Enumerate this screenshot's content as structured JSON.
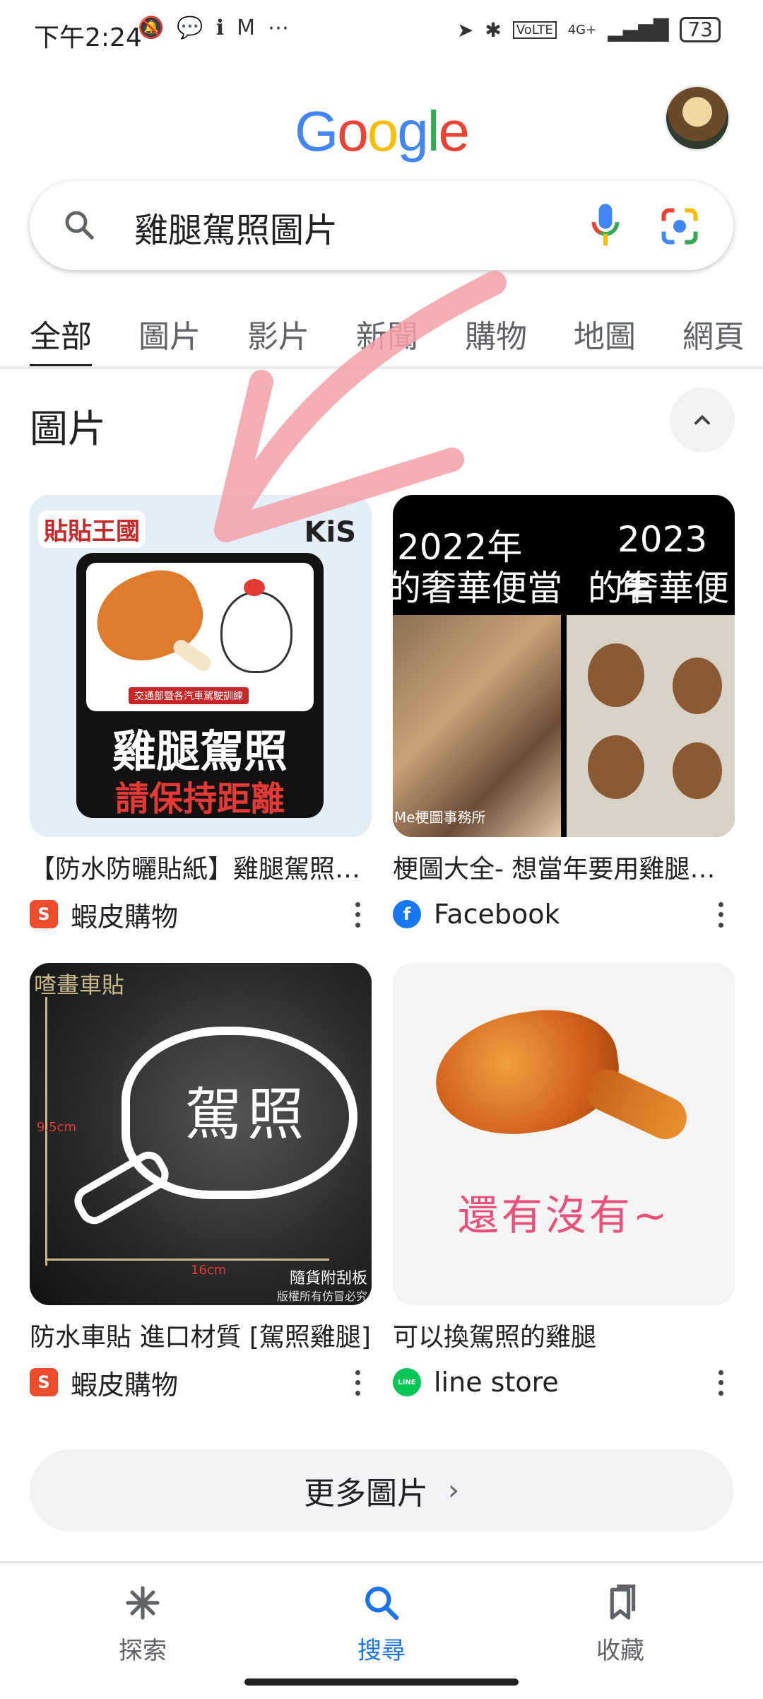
{
  "status_bar": {
    "time": "下午2:24",
    "network": "4G+",
    "battery": "73"
  },
  "header": {
    "logo_letters": [
      {
        "ch": "G",
        "color": "blue"
      },
      {
        "ch": "o",
        "color": "red"
      },
      {
        "ch": "o",
        "color": "yellow"
      },
      {
        "ch": "g",
        "color": "blue"
      },
      {
        "ch": "l",
        "color": "green"
      },
      {
        "ch": "e",
        "color": "red"
      }
    ]
  },
  "search": {
    "query": "雞腿駕照圖片"
  },
  "tabs": [
    {
      "label": "全部",
      "active": true
    },
    {
      "label": "圖片",
      "active": false
    },
    {
      "label": "影片",
      "active": false
    },
    {
      "label": "新聞",
      "active": false
    },
    {
      "label": "購物",
      "active": false
    },
    {
      "label": "地圖",
      "active": false
    },
    {
      "label": "網頁",
      "active": false
    }
  ],
  "images_section": {
    "title": "圖片",
    "cards": [
      {
        "title": "【防水防曬貼紙】雞腿駕照請保持距離",
        "source": "蝦皮購物",
        "thumb_text_top": "貼貼王國",
        "thumb_text_brand": "KiS",
        "thumb_text_main": "雞腿駕照",
        "thumb_text_sub": "請保持距離",
        "thumb_text_small": "交通部暨各汽車駕駛訓練"
      },
      {
        "title": "梗圖大全- 想當年要用雞腿換駕照",
        "source": "Facebook",
        "thumb_text_left": "2022年",
        "thumb_text_left2": "的奢華便當",
        "thumb_text_right": "2023年",
        "thumb_text_right2": "的奢華便當",
        "thumb_caption": "Me梗圖事務所"
      },
      {
        "title": "防水車貼 進口材質 [駕照雞腿]",
        "source": "蝦皮購物",
        "thumb_text_top": "喳畫車貼",
        "thumb_text_main": "駕照",
        "thumb_text_dim_v": "9.5cm",
        "thumb_text_dim_h": "16cm",
        "thumb_text_note": "隨貨附刮板",
        "thumb_text_note2": "版權所有仿冒必究"
      },
      {
        "title": "可以換駕照的雞腿",
        "source": "line store",
        "thumb_text_main": "還有沒有~"
      }
    ],
    "more_button": "更多圖片"
  },
  "bottom_nav": [
    {
      "label": "探索",
      "icon": "asterisk-icon",
      "active": false
    },
    {
      "label": "搜尋",
      "icon": "search-icon",
      "active": true
    },
    {
      "label": "收藏",
      "icon": "bookmarks-icon",
      "active": false
    }
  ],
  "colors": {
    "accent_blue": "#1a73e8",
    "google_blue": "#4285f4",
    "google_red": "#ea4335",
    "google_yellow": "#fbbc05",
    "google_green": "#34a853",
    "shopee_orange": "#ee4d2d",
    "facebook_blue": "#1877f2",
    "line_green": "#06c755",
    "overlay_arrow": "#f4a0a8"
  }
}
